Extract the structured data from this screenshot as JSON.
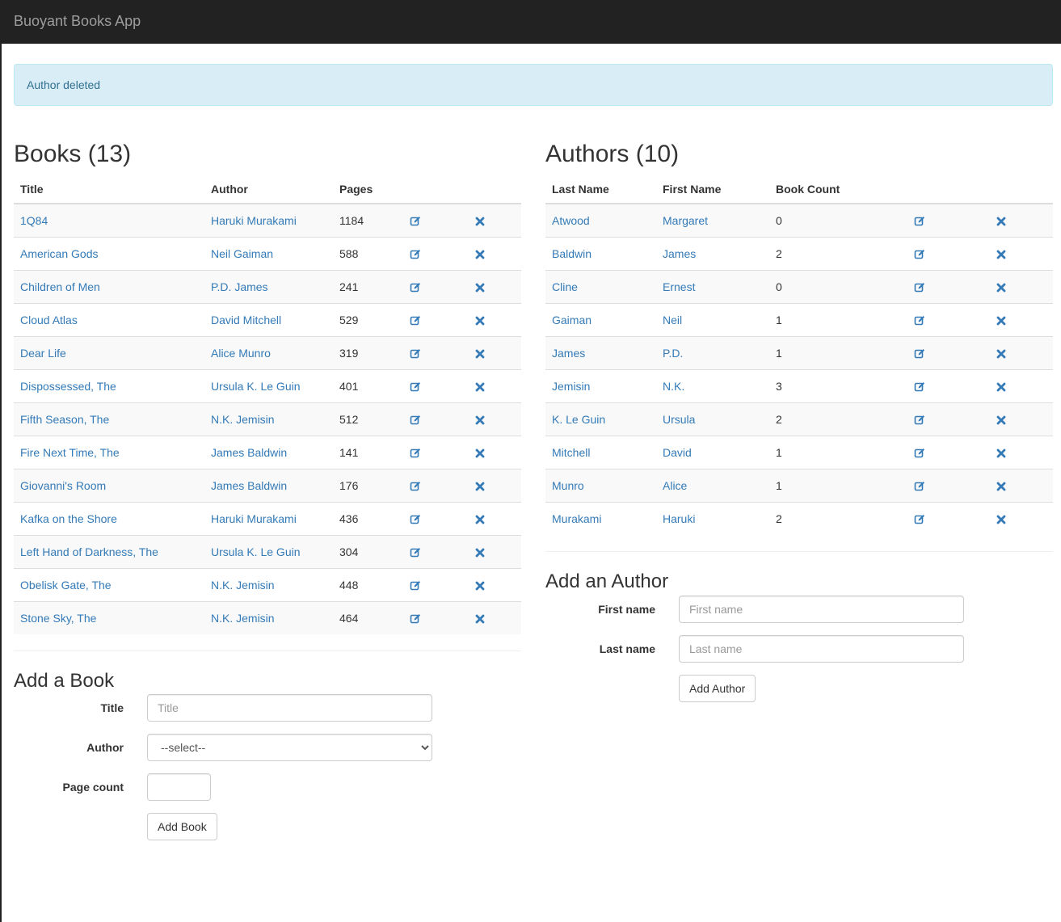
{
  "navbar": {
    "brand": "Buoyant Books App"
  },
  "alert": {
    "message": "Author deleted"
  },
  "books": {
    "heading": "Books (13)",
    "columns": {
      "title": "Title",
      "author": "Author",
      "pages": "Pages"
    },
    "rows": [
      {
        "title": "1Q84",
        "author": "Haruki Murakami",
        "pages": "1184"
      },
      {
        "title": "American Gods",
        "author": "Neil Gaiman",
        "pages": "588"
      },
      {
        "title": "Children of Men",
        "author": "P.D. James",
        "pages": "241"
      },
      {
        "title": "Cloud Atlas",
        "author": "David Mitchell",
        "pages": "529"
      },
      {
        "title": "Dear Life",
        "author": "Alice Munro",
        "pages": "319"
      },
      {
        "title": "Dispossessed, The",
        "author": "Ursula K. Le Guin",
        "pages": "401"
      },
      {
        "title": "Fifth Season, The",
        "author": "N.K. Jemisin",
        "pages": "512"
      },
      {
        "title": "Fire Next Time, The",
        "author": "James Baldwin",
        "pages": "141"
      },
      {
        "title": "Giovanni's Room",
        "author": "James Baldwin",
        "pages": "176"
      },
      {
        "title": "Kafka on the Shore",
        "author": "Haruki Murakami",
        "pages": "436"
      },
      {
        "title": "Left Hand of Darkness, The",
        "author": "Ursula K. Le Guin",
        "pages": "304"
      },
      {
        "title": "Obelisk Gate, The",
        "author": "N.K. Jemisin",
        "pages": "448"
      },
      {
        "title": "Stone Sky, The",
        "author": "N.K. Jemisin",
        "pages": "464"
      }
    ]
  },
  "authors": {
    "heading": "Authors (10)",
    "columns": {
      "last": "Last Name",
      "first": "First Name",
      "count": "Book Count"
    },
    "rows": [
      {
        "last": "Atwood",
        "first": "Margaret",
        "count": "0"
      },
      {
        "last": "Baldwin",
        "first": "James",
        "count": "2"
      },
      {
        "last": "Cline",
        "first": "Ernest",
        "count": "0"
      },
      {
        "last": "Gaiman",
        "first": "Neil",
        "count": "1"
      },
      {
        "last": "James",
        "first": "P.D.",
        "count": "1"
      },
      {
        "last": "Jemisin",
        "first": "N.K.",
        "count": "3"
      },
      {
        "last": "K. Le Guin",
        "first": "Ursula",
        "count": "2"
      },
      {
        "last": "Mitchell",
        "first": "David",
        "count": "1"
      },
      {
        "last": "Munro",
        "first": "Alice",
        "count": "1"
      },
      {
        "last": "Murakami",
        "first": "Haruki",
        "count": "2"
      }
    ]
  },
  "add_book": {
    "heading": "Add a Book",
    "title_label": "Title",
    "title_placeholder": "Title",
    "author_label": "Author",
    "author_selected": "--select--",
    "pages_label": "Page count",
    "submit_label": "Add Book"
  },
  "add_author": {
    "heading": "Add an Author",
    "first_label": "First name",
    "first_placeholder": "First name",
    "last_label": "Last name",
    "last_placeholder": "Last name",
    "submit_label": "Add Author"
  },
  "icons": {
    "edit": "edit-icon",
    "delete": "delete-icon"
  },
  "colors": {
    "link": "#337ab7",
    "navbar": "#222222",
    "alert_bg": "#d9edf7"
  }
}
